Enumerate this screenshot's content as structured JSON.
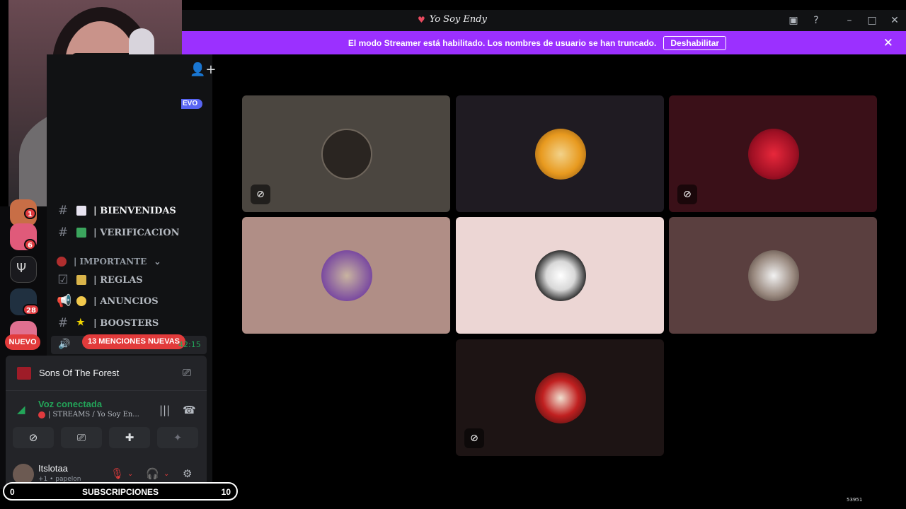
{
  "window": {
    "title": "Yo Soy Endy",
    "title_icon": "heart-icon"
  },
  "banner": {
    "text": "El modo Streamer está habilitado. Los nombres de usuario se han truncado.",
    "button_label": "Deshabilitar",
    "color": "#9b30ff"
  },
  "sidebar": {
    "nuevo_tag": "EVO",
    "channels": [
      {
        "name": "| BIENVENIDAS",
        "icon": "hash-icon"
      },
      {
        "name": "| VERIFICACION",
        "icon": "hash-icon"
      },
      {
        "name": "| IMPORTANTE",
        "icon": "category-icon"
      },
      {
        "name": "| REGLAS",
        "icon": "rules-icon"
      },
      {
        "name": "| ANUNCIOS",
        "icon": "megaphone-icon"
      },
      {
        "name": "| BOOSTERS",
        "icon": "hash-icon"
      }
    ],
    "mentions_pill": "13 MENCIONES NUEVAS",
    "voice_timer": "42:15",
    "nuevo_pill": "NUEVO"
  },
  "servers": [
    {
      "badge": "1"
    },
    {
      "badge": "6"
    },
    {
      "badge": ""
    },
    {
      "badge": "28"
    },
    {
      "badge": ""
    }
  ],
  "activity": {
    "game_name": "Sons Of The Forest"
  },
  "voice": {
    "status": "Voz conectada",
    "channel": "| STREAMS / Yo Soy En..."
  },
  "user": {
    "name": "Itslotaa",
    "sub": "+1 • papelon"
  },
  "subscriptions": {
    "left": "0",
    "label": "SUBSCRIPCIONES",
    "right": "10"
  },
  "corner_number": "53951",
  "colors": {
    "accent": "#9b30ff",
    "voice_green": "#23a559",
    "alert_red": "#e23b3b"
  }
}
